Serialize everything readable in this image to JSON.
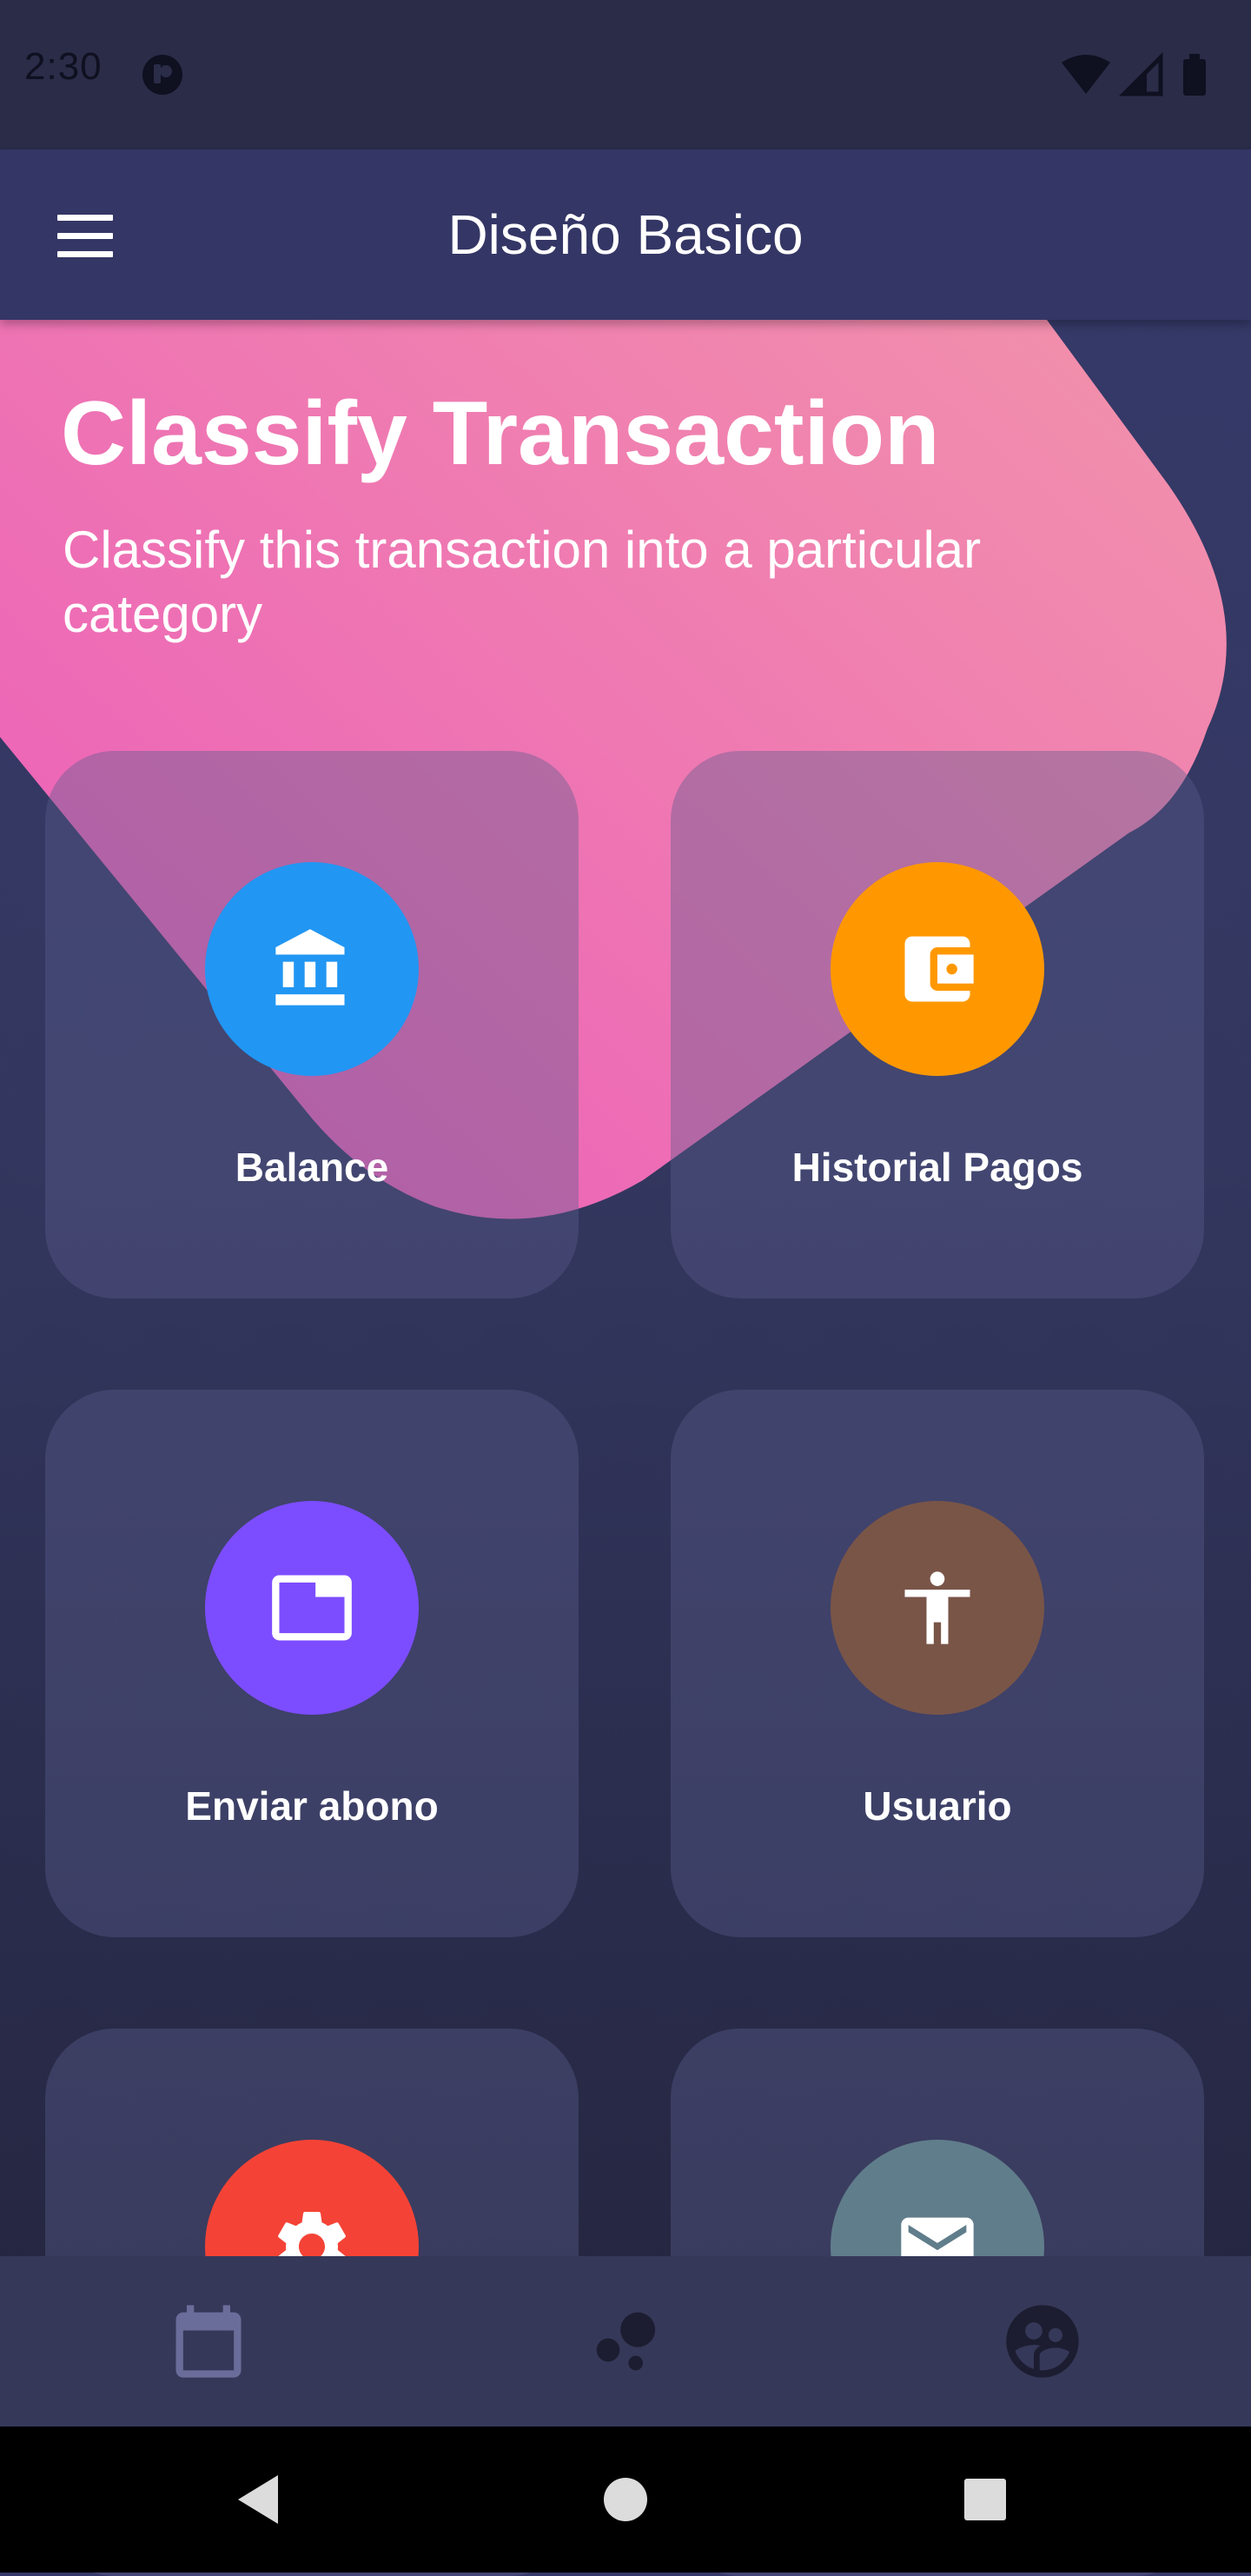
{
  "status_bar": {
    "time": "2:30",
    "icons": [
      "app-notification-icon",
      "wifi-icon",
      "signal-icon",
      "battery-icon"
    ]
  },
  "app_bar": {
    "title": "Diseño Basico",
    "menu_icon": "hamburger-menu-icon"
  },
  "header": {
    "title": "Classify Transaction",
    "subtitle": "Classify this transaction into a particular category"
  },
  "cards": [
    {
      "label": "Balance",
      "icon": "bank-icon",
      "color": "#2196f3"
    },
    {
      "label": "Historial Pagos",
      "icon": "wallet-icon",
      "color": "#ff9800"
    },
    {
      "label": "Enviar abono",
      "icon": "tab-icon",
      "color": "#7c4dff"
    },
    {
      "label": "Usuario",
      "icon": "accessibility-icon",
      "color": "#795548"
    },
    {
      "label": "",
      "icon": "settings-icon",
      "color": "#f44336"
    },
    {
      "label": "",
      "icon": "mail-icon",
      "color": "#607d8b"
    }
  ],
  "bottom_nav": {
    "items": [
      {
        "icon": "calendar-icon",
        "color": "#6a6d9a"
      },
      {
        "icon": "bubble-chart-icon",
        "color": "#1c1d30"
      },
      {
        "icon": "supervised-user-circle-icon",
        "color": "#1c1d30"
      }
    ]
  },
  "system_nav": {
    "items": [
      "back-icon",
      "home-icon",
      "recents-icon"
    ]
  },
  "colors": {
    "status_bar": "#2a2c48",
    "app_bar": "#343665",
    "background_top": "#363a6b",
    "background_bottom": "#222339",
    "pink_gradient_start": "#ec5fb9",
    "pink_gradient_end": "#f293ab",
    "card": "#444879",
    "bottom_nav": "#363859"
  }
}
